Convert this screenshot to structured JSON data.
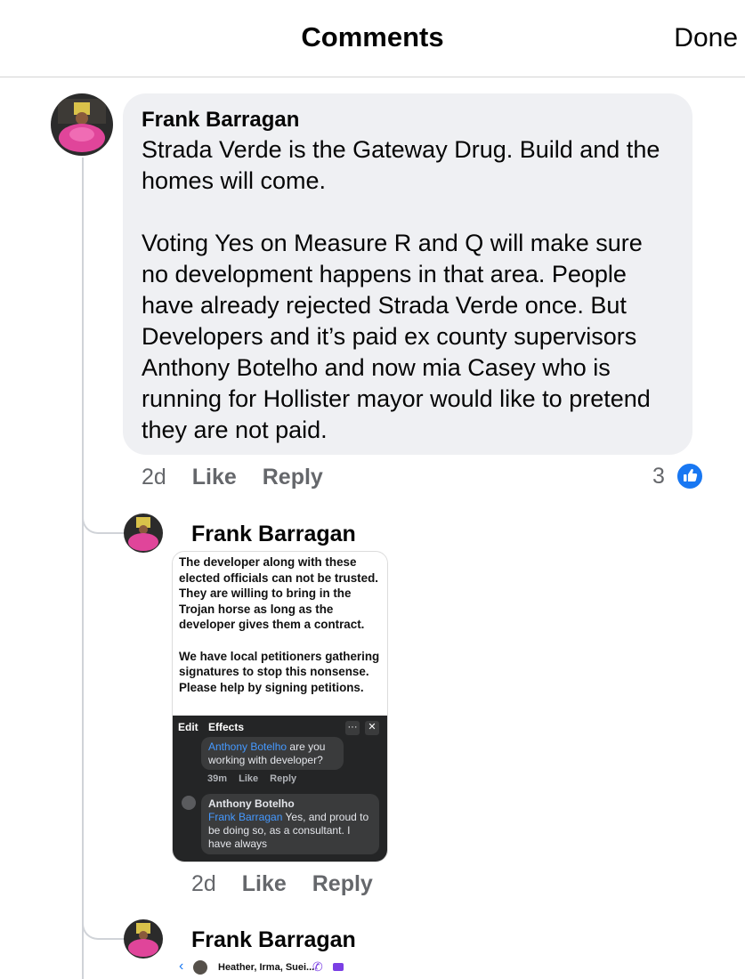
{
  "header": {
    "title": "Comments",
    "done_label": "Done"
  },
  "comments": [
    {
      "author": "Frank Barragan",
      "paragraphs": [
        "Strada Verde is the Gateway Drug.  Build and the homes will come.",
        "Voting Yes on Measure R and Q will make sure no development happens in that area. People have already rejected Strada Verde once.  But Developers and it’s paid ex county supervisors Anthony Botelho and now mia Casey who is running for Hollister mayor would like to pretend they are not paid."
      ],
      "time": "2d",
      "like_label": "Like",
      "reply_label": "Reply",
      "reaction_count": "3",
      "reaction_icon": "like-thumb-icon",
      "reaction_color": "#1877f2"
    }
  ],
  "replies": [
    {
      "author": "Frank Barragan",
      "screenshot": {
        "paragraphs": [
          "The developer along with these elected officials can not be trusted.  They are willing to bring in the Trojan horse as long as the developer gives them a contract.",
          "We have local petitioners gathering signatures to stop this nonsense.  Please help by signing petitions."
        ],
        "edit_label": "Edit",
        "effects_label": "Effects",
        "more_icon": "···",
        "close_icon": "✕",
        "inner_comment_1": {
          "mention": "Anthony Botelho",
          "text": "are you working with developer?"
        },
        "inner_time": "39m",
        "inner_like": "Like",
        "inner_reply": "Reply",
        "inner_comment_2": {
          "author": "Anthony Botelho",
          "mention": "Frank Barragan",
          "text": "Yes, and proud to be doing so, as a consultant. I have always"
        }
      },
      "time": "2d",
      "like_label": "Like",
      "reply_label": "Reply"
    },
    {
      "author": "Frank Barragan",
      "screenshot": {
        "chat_names": "Heather, Irma, Suei..."
      }
    }
  ]
}
